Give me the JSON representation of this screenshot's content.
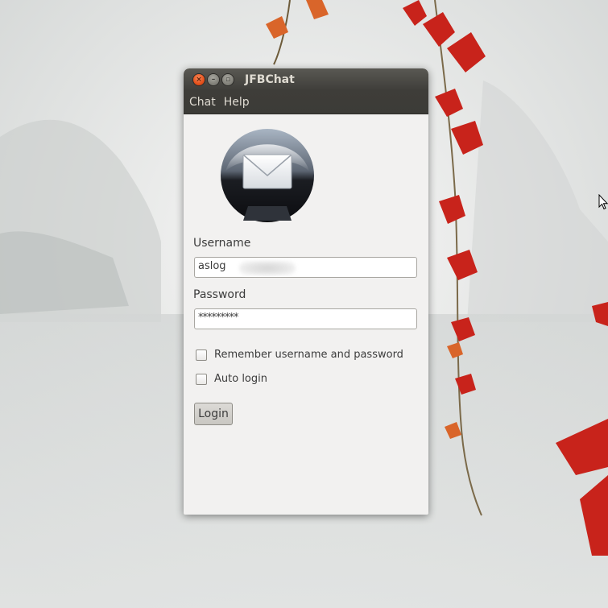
{
  "window": {
    "title": "JFBChat",
    "close_glyph": "×",
    "minimize_glyph": "–",
    "maximize_glyph": "▫"
  },
  "menu": {
    "items": [
      {
        "label": "Chat"
      },
      {
        "label": "Help"
      }
    ]
  },
  "logo": {
    "icon": "envelope-icon"
  },
  "form": {
    "username_label": "Username",
    "username_value": "aslog",
    "password_label": "Password",
    "password_value": "*********",
    "remember_label": "Remember username and password",
    "remember_checked": false,
    "autologin_label": "Auto login",
    "autologin_checked": false,
    "login_button": "Login"
  },
  "colors": {
    "titlebar": "#3c3b37",
    "window_bg": "#f2f1f0",
    "close_button": "#e5501b",
    "text": "#3c3c3c"
  }
}
